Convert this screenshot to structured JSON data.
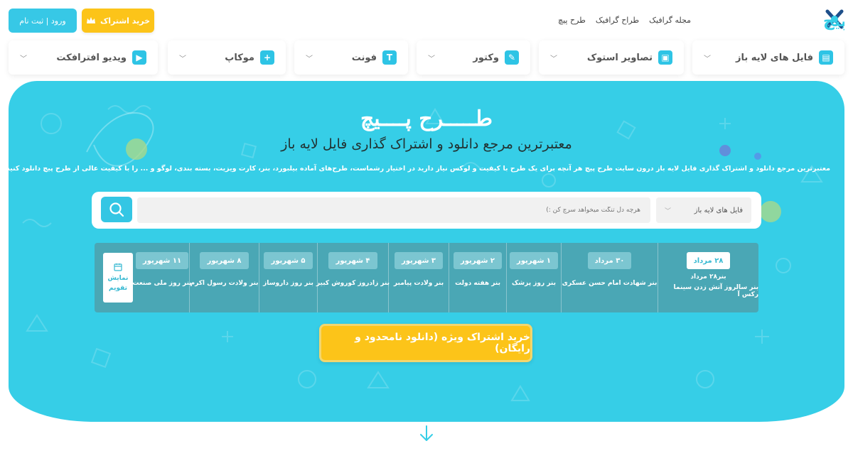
{
  "header": {
    "logo_text": "طرح پیچ",
    "links": [
      "مجله گرافیک",
      "طراح گرافیک",
      "طرح پیچ"
    ],
    "subscribe_label": "خرید اشتراک",
    "login_label": "ورود | ثبت نام"
  },
  "categories": [
    {
      "label": "فایل های لایه باز",
      "icon": "layers-icon"
    },
    {
      "label": "تصاویر استوک",
      "icon": "image-icon"
    },
    {
      "label": "وکتور",
      "icon": "pen-icon"
    },
    {
      "label": "فونت",
      "icon": "font-icon"
    },
    {
      "label": "موکاپ",
      "icon": "mockup-icon"
    },
    {
      "label": "ویدیو افترافکت",
      "icon": "video-icon"
    }
  ],
  "hero": {
    "brand": "طـــــرح پــــیچ",
    "subtitle": "معتبرترین مرجع دانلود و اشتراک گذاری فایل لایه باز",
    "description": "معتبرترین مرجع دانلود و اشتراک گذاری فایل لایه باز درون سایت طرح پیچ هر آنچه برای یک طرح با کیفیت و لوکس نیاز دارید در اختیار رشماست، طرح‌های آماده بیلبورد، بنر، کارت ویزیت، بسته بندی، لوگو و ... را با کیفیت عالی از طرح پیچ دانلود کنید، فقط کافی است جستجو کنید!"
  },
  "search": {
    "placeholder": "هرچه دل تنگت میخواهد سرچ کن :)",
    "category_selected": "فایل های لایه باز"
  },
  "calendar": {
    "show_label_1": "نمایش",
    "show_label_2": "تقویم",
    "days": [
      {
        "date": "۲۸ مرداد",
        "events": [
          "بنر۲۸ مرداد",
          "بنر سالروز آتش زدن سینما رکس آ"
        ],
        "active": true
      },
      {
        "date": "۳۰ مرداد",
        "events": [
          "بنر شهادت امام حسن عسکری"
        ],
        "active": false
      },
      {
        "date": "۱ شهریور",
        "events": [
          "بنر روز پزشک"
        ],
        "active": false
      },
      {
        "date": "۲ شهریور",
        "events": [
          "بنر هفته دولت"
        ],
        "active": false
      },
      {
        "date": "۳ شهریور",
        "events": [
          "بنر ولادت پیامبر"
        ],
        "active": false
      },
      {
        "date": "۴ شهریور",
        "events": [
          "بنر زادروز کوروش کبیر"
        ],
        "active": false
      },
      {
        "date": "۵ شهریور",
        "events": [
          "بنر روز داروساز"
        ],
        "active": false
      },
      {
        "date": "۸ شهریور",
        "events": [
          "بنر ولادت رسول اکرم"
        ],
        "active": false
      },
      {
        "date": "۱۱ شهریور",
        "events": [
          "بنر روز ملی صنعت"
        ],
        "active": false
      }
    ]
  },
  "cta": {
    "label": "خرید اشتراک ویژه (دانلود نامحدود و رایگان)"
  },
  "colors": {
    "primary": "#36cee7",
    "accent": "#fcc419",
    "calendar_bg": "#4aa7b5"
  }
}
